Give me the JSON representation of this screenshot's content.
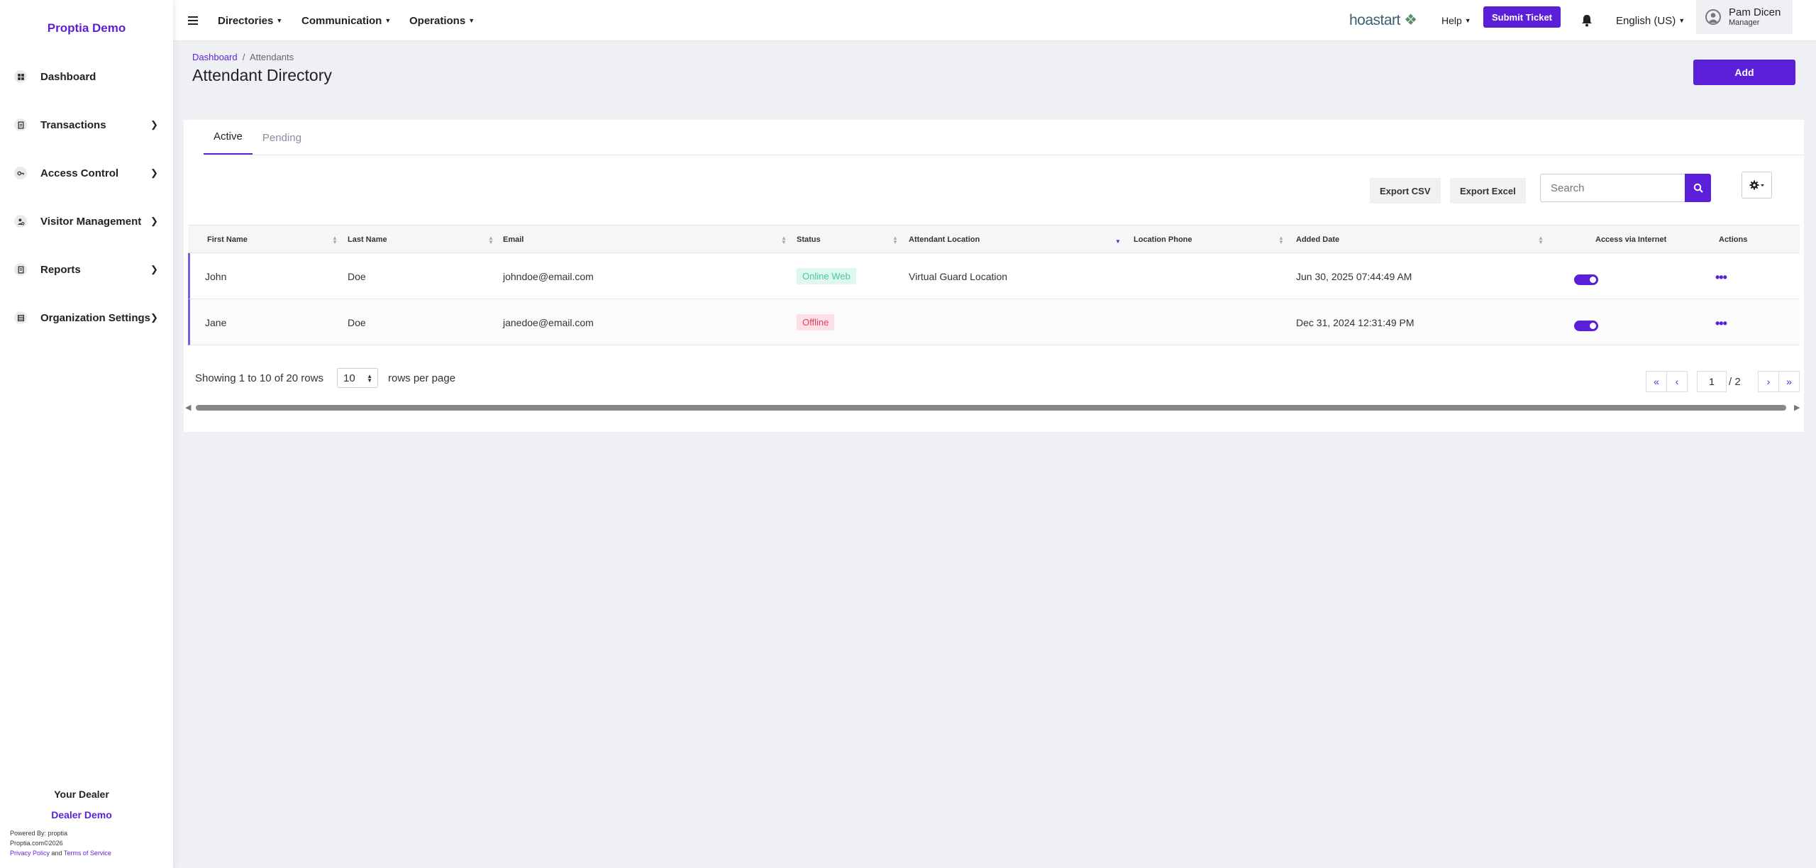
{
  "sidebar": {
    "brand": "Proptia Demo",
    "items": [
      {
        "label": "Dashboard",
        "icon": "dashboard-icon",
        "has_children": false
      },
      {
        "label": "Transactions",
        "icon": "receipt-icon",
        "has_children": true
      },
      {
        "label": "Access Control",
        "icon": "key-icon",
        "has_children": true
      },
      {
        "label": "Visitor Management",
        "icon": "visitor-icon",
        "has_children": true
      },
      {
        "label": "Reports",
        "icon": "report-icon",
        "has_children": true
      },
      {
        "label": "Organization Settings",
        "icon": "building-icon",
        "has_children": true
      }
    ],
    "dealer_heading": "Your Dealer",
    "dealer_name": "Dealer Demo",
    "powered_by": "Powered By: proptia",
    "copyright": "Proptia.com©2026",
    "privacy": "Privacy Policy",
    "and": "and",
    "terms": "Terms of Service"
  },
  "topbar": {
    "menus": [
      "Directories",
      "Communication",
      "Operations"
    ],
    "brand_logo": "hoastart",
    "help": "Help",
    "submit_ticket": "Submit Ticket",
    "language": "English (US)",
    "user_name": "Pam Dicen",
    "user_role": "Manager"
  },
  "page": {
    "breadcrumb": [
      "Dashboard",
      "Attendants"
    ],
    "title": "Attendant Directory",
    "add_label": "Add"
  },
  "tabs": [
    "Active",
    "Pending"
  ],
  "toolbar": {
    "export_csv": "Export CSV",
    "export_excel": "Export Excel",
    "search_placeholder": "Search"
  },
  "table": {
    "columns": [
      "First Name",
      "Last Name",
      "Email",
      "Status",
      "Attendant Location",
      "Location Phone",
      "Added Date",
      "Access via Internet",
      "Actions"
    ],
    "rows": [
      {
        "first": "John",
        "last": "Doe",
        "email": "johndoe@email.com",
        "status": "Online Web",
        "status_kind": "online",
        "location": "Virtual Guard Location",
        "phone": "",
        "added": "Jun 30, 2025 07:44:49 AM",
        "internet": true
      },
      {
        "first": "Jane",
        "last": "Doe",
        "email": "janedoe@email.com",
        "status": "Offline",
        "status_kind": "offline",
        "location": "",
        "phone": "",
        "added": "Dec 31, 2024 12:31:49 PM",
        "internet": true
      }
    ]
  },
  "pagination": {
    "showing": "Showing 1 to 10 of 20 rows",
    "per_page": "10",
    "rows_per_page": "rows per page",
    "current_page": "1",
    "of_pages": "/ 2"
  },
  "colors": {
    "accent": "#5b1fd8",
    "online": "#4cc7a0",
    "offline": "#e1405f"
  }
}
